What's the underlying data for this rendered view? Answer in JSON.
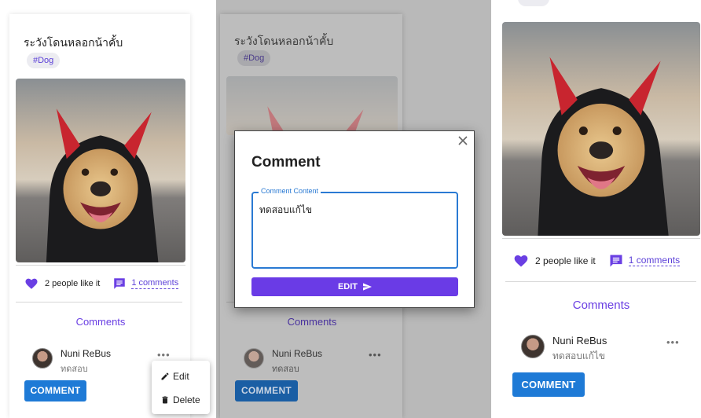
{
  "post": {
    "title": "ระวังโดนหลอกน้าคั้บ",
    "tag": "#Dog",
    "likes_text": "2 people like it",
    "comments_link": "1 comments",
    "comments_heading": "Comments"
  },
  "panel1": {
    "comment": {
      "author": "Nuni ReBus",
      "text": "ทดสอบ"
    },
    "comment_button": "COMMENT",
    "menu": {
      "edit": "Edit",
      "delete": "Delete"
    }
  },
  "panel2": {
    "comment": {
      "author": "Nuni ReBus",
      "text": "ทดสอบ"
    },
    "comment_button": "COMMENT",
    "modal": {
      "title": "Comment",
      "field_label": "Comment Content",
      "field_value": "ทดสอบแก้ไข",
      "submit_label": "EDIT"
    }
  },
  "panel3": {
    "comment": {
      "author": "Nuni ReBus",
      "text": "ทดสอบแก้ไข"
    },
    "comment_button": "COMMENT"
  },
  "colors": {
    "accent": "#6a3fe3",
    "button_blue": "#1e7ad6",
    "edit_purple": "#6a3be6"
  }
}
